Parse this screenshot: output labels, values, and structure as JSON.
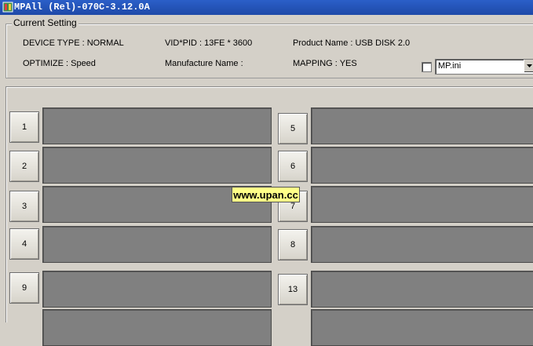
{
  "window": {
    "title": "MPAll (Rel)-070C-3.12.0A",
    "icon": "app-icon"
  },
  "current_setting": {
    "legend": "Current Setting",
    "device_type": "DEVICE TYPE : NORMAL",
    "vid_pid": "VID*PID : 13FE * 3600",
    "product_name": "Product Name : USB DISK 2.0",
    "optimize": "OPTIMIZE : Speed",
    "manufacture_name": "Manufacture Name :",
    "mapping": "MAPPING : YES",
    "ini_checkbox_checked": false,
    "ini_select_value": "MP.ini"
  },
  "ports": {
    "left": [
      "1",
      "2",
      "3",
      "4",
      "9"
    ],
    "right": [
      "5",
      "6",
      "7",
      "8",
      "13"
    ]
  },
  "watermark": "www.upan.cc",
  "colors": {
    "titlebar": "#2b5fc8",
    "slot_bar": "#808080",
    "watermark_bg": "#ffff88"
  }
}
